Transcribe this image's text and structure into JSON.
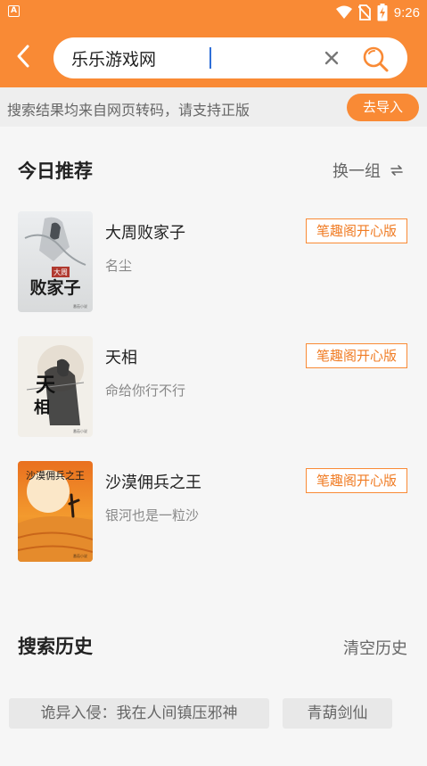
{
  "status_bar": {
    "app_icon_letter": "A",
    "time": "9:26",
    "icons": [
      "wifi-icon",
      "no-sim-icon",
      "battery-charging-icon"
    ]
  },
  "search": {
    "value": "乐乐游戏网",
    "back_icon": "chevron-left-icon",
    "clear_icon": "close-icon",
    "search_icon": "search-icon"
  },
  "notice": {
    "text": "搜索结果均来自网页转码，请支持正版",
    "import_label": "去导入"
  },
  "recommend": {
    "title": "今日推荐",
    "refresh_label": "换一组",
    "books": [
      {
        "title": "大周败家子",
        "author": "名尘",
        "source": "笔趣阁开心版",
        "cover_text": "大周败家子"
      },
      {
        "title": "天相",
        "author": "命给你行不行",
        "source": "笔趣阁开心版",
        "cover_text": "天相"
      },
      {
        "title": "沙漠佣兵之王",
        "author": "银河也是一粒沙",
        "source": "笔趣阁开心版",
        "cover_text": "沙漠佣兵之王"
      }
    ]
  },
  "history": {
    "title": "搜索历史",
    "clear_label": "清空历史",
    "items": [
      "诡异入侵：我在人间镇压邪神",
      "青葫剑仙"
    ]
  },
  "colors": {
    "accent": "#f98a35",
    "tag_text": "#f07c24",
    "background": "#f6f6f6"
  }
}
